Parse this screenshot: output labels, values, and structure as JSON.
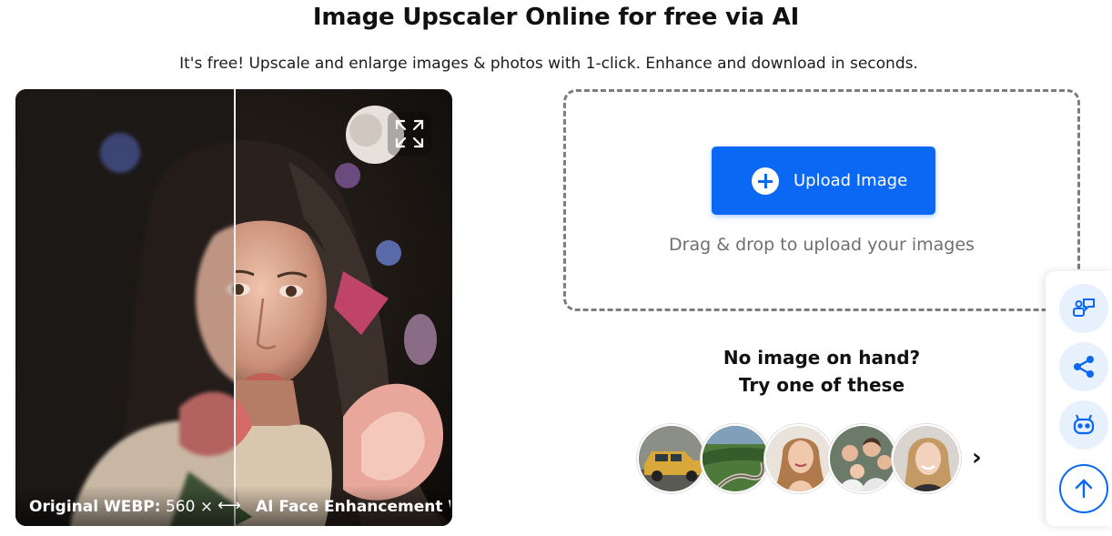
{
  "page": {
    "title": "Image Upscaler Online for free via AI",
    "subtitle": "It's free! Upscale and enlarge images & photos with 1-click. Enhance and download in seconds."
  },
  "compare": {
    "left_label_bold": "Original WEBP:",
    "left_label_rest": " 560 × ...",
    "arrow": "⟷",
    "right_label": "AI Face Enhancement W...",
    "fullscreen_icon": "expand-icon"
  },
  "upload": {
    "button_label": "Upload Image",
    "drag_text": "Drag & drop to upload your images"
  },
  "samples": {
    "heading_line1": "No image on hand?",
    "heading_line2": "Try one of these",
    "items": [
      "yellow-car",
      "winding-road",
      "woman-portrait",
      "family-photo",
      "smiling-woman"
    ],
    "next_label": "›"
  },
  "sidebar": {
    "items": [
      "feedback-icon",
      "share-icon",
      "robot-icon",
      "arrow-up-icon"
    ]
  },
  "colors": {
    "accent": "#0a68f5",
    "border": "#7d7d7d",
    "muted_text": "#6f6f6f"
  }
}
